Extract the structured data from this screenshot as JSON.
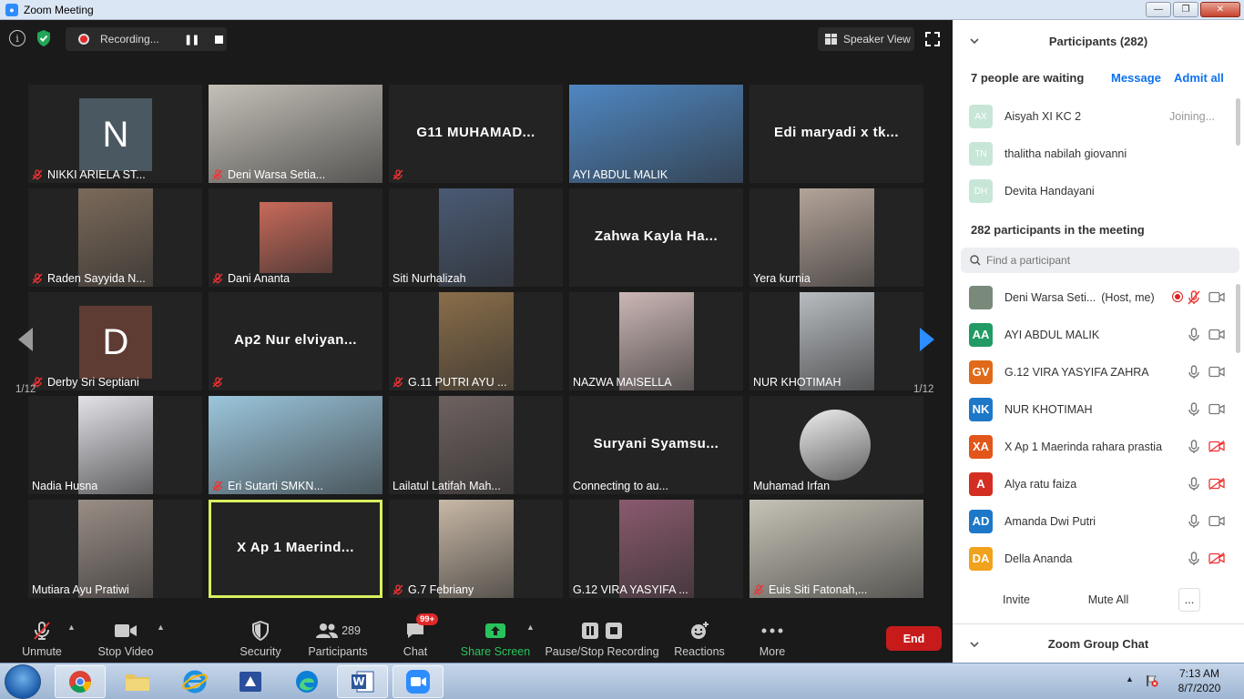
{
  "window": {
    "title": "Zoom Meeting"
  },
  "meeting": {
    "recording_label": "Recording...",
    "speaker_view_label": "Speaker View",
    "page_indicator_left": "1/12",
    "page_indicator_right": "1/12"
  },
  "tiles": [
    {
      "name": "NIKKI ARIELA ST...",
      "muted": true,
      "kind": "avatar",
      "initial": "N",
      "color": "#4a5862"
    },
    {
      "name": "Deni Warsa Setia...",
      "muted": true,
      "kind": "video",
      "color": "#c4c0b8"
    },
    {
      "name": "",
      "big": "G11 MUHAMAD...",
      "muted": true,
      "kind": "text"
    },
    {
      "name": "AYI ABDUL MALIK",
      "muted": false,
      "kind": "video",
      "color": "#4f87c2"
    },
    {
      "name": "",
      "big": "Edi maryadi x tk...",
      "muted": false,
      "kind": "text"
    },
    {
      "name": "Raden Sayyida N...",
      "muted": true,
      "kind": "video",
      "color": "#7b6a5a"
    },
    {
      "name": "Dani Ananta",
      "muted": true,
      "kind": "video",
      "color": "#c86a5a"
    },
    {
      "name": "Siti Nurhalizah",
      "muted": false,
      "kind": "video",
      "color": "#4a5a74"
    },
    {
      "name": "",
      "big": "Zahwa Kayla Ha...",
      "muted": false,
      "kind": "text"
    },
    {
      "name": "Yera kurnia",
      "muted": false,
      "kind": "video",
      "color": "#b4a49a"
    },
    {
      "name": "Derby Sri Septiani",
      "muted": true,
      "kind": "avatar",
      "initial": "D",
      "color": "#5e3b33"
    },
    {
      "name": "",
      "big": "Ap2 Nur elviyan...",
      "muted": true,
      "kind": "text"
    },
    {
      "name": "G.11 PUTRI AYU ...",
      "muted": true,
      "kind": "video",
      "color": "#8a6e4a"
    },
    {
      "name": "NAZWA MAISELLA",
      "muted": false,
      "kind": "video",
      "color": "#cbb7b5"
    },
    {
      "name": "NUR KHOTIMAH",
      "muted": false,
      "kind": "video",
      "color": "#b8bcc0"
    },
    {
      "name": "Nadia Husna",
      "muted": false,
      "kind": "video",
      "color": "#e2e2e8"
    },
    {
      "name": "Eri Sutarti SMKN...",
      "muted": true,
      "kind": "video",
      "color": "#9bc6dc"
    },
    {
      "name": "Lailatul Latifah Mah...",
      "muted": false,
      "kind": "video",
      "color": "#6e6260"
    },
    {
      "name": "Connecting to au...",
      "big": "Suryani Syamsu...",
      "muted": false,
      "kind": "text"
    },
    {
      "name": "Muhamad Irfan",
      "muted": false,
      "kind": "photo",
      "color": "#eeeeee"
    },
    {
      "name": "Mutiara Ayu Pratiwi",
      "muted": false,
      "kind": "video",
      "color": "#9a8e86"
    },
    {
      "name": "",
      "big": "X Ap 1 Maerind...",
      "muted": false,
      "kind": "text",
      "active": true
    },
    {
      "name": "G.7 Febriany",
      "muted": true,
      "kind": "video",
      "color": "#c8b8a6"
    },
    {
      "name": "G.12 VIRA YASYIFA ...",
      "muted": false,
      "kind": "video",
      "color": "#8a5a6e"
    },
    {
      "name": "Euis Siti Fatonah,...",
      "muted": true,
      "kind": "video",
      "color": "#c6c2b6"
    }
  ],
  "toolbar": {
    "unmute": "Unmute",
    "stop_video": "Stop Video",
    "security": "Security",
    "participants_count": "289",
    "participants": "Participants",
    "chat_badge": "99+",
    "chat": "Chat",
    "share_screen": "Share Screen",
    "pause_stop_recording": "Pause/Stop Recording",
    "reactions": "Reactions",
    "more": "More",
    "end": "End"
  },
  "panel": {
    "title": "Participants (282)",
    "waiting_text": "7 people are waiting",
    "message_link": "Message",
    "admit_all_link": "Admit all",
    "waiting": [
      {
        "initials": "AX",
        "name": "Aisyah XI KC 2",
        "status": "Joining..."
      },
      {
        "initials": "TN",
        "name": "thalitha nabilah giovanni",
        "status": ""
      },
      {
        "initials": "DH",
        "name": "Devita Handayani",
        "status": ""
      }
    ],
    "in_meeting_title": "282 participants in the meeting",
    "search_placeholder": "Find a participant",
    "participants": [
      {
        "initials": "",
        "name": "Deni Warsa Seti...",
        "host": "(Host, me)",
        "color": "#7a8a7a",
        "mic": "muted",
        "cam": "on",
        "rec": true
      },
      {
        "initials": "AA",
        "name": "AYI ABDUL MALIK",
        "host": "",
        "color": "#229a64",
        "mic": "on",
        "cam": "on",
        "rec": false
      },
      {
        "initials": "GV",
        "name": "G.12 VIRA YASYIFA ZAHRA",
        "host": "",
        "color": "#e06a1a",
        "mic": "on",
        "cam": "on",
        "rec": false
      },
      {
        "initials": "NK",
        "name": "NUR KHOTIMAH",
        "host": "",
        "color": "#1e78c8",
        "mic": "on",
        "cam": "on",
        "rec": false
      },
      {
        "initials": "XA",
        "name": "X Ap 1 Maerinda rahara prastia",
        "host": "",
        "color": "#e2561a",
        "mic": "on",
        "cam": "off",
        "rec": false
      },
      {
        "initials": "A",
        "name": "Alya ratu faiza",
        "host": "",
        "color": "#d42e22",
        "mic": "on",
        "cam": "off",
        "rec": false
      },
      {
        "initials": "AD",
        "name": "Amanda Dwi Putri",
        "host": "",
        "color": "#1e78c8",
        "mic": "on",
        "cam": "on",
        "rec": false
      },
      {
        "initials": "DA",
        "name": "Della Ananda",
        "host": "",
        "color": "#f0a21c",
        "mic": "on",
        "cam": "off",
        "rec": false
      }
    ],
    "invite": "Invite",
    "mute_all": "Mute All",
    "more": "...",
    "chat_title": "Zoom Group Chat"
  },
  "taskbar": {
    "time": "7:13 AM",
    "date": "8/7/2020"
  }
}
